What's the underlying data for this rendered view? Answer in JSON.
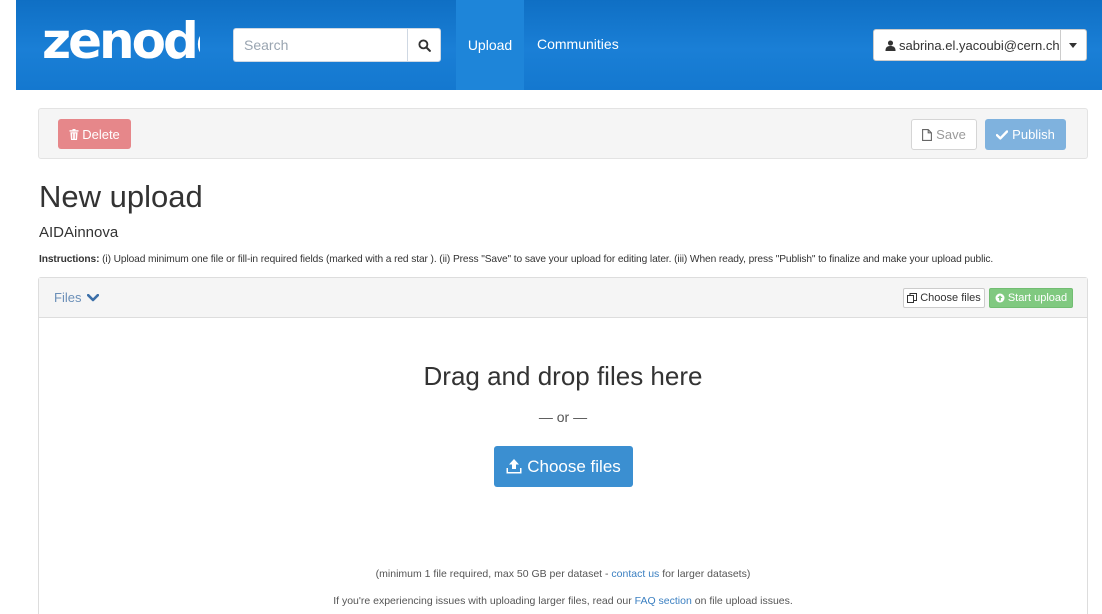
{
  "navbar": {
    "logo_text": "zenodo",
    "search_placeholder": "Search",
    "upload_label": "Upload",
    "communities_label": "Communities",
    "user_email": "sabrina.el.yacoubi@cern.ch"
  },
  "toolbar": {
    "delete_label": "Delete",
    "save_label": "Save",
    "publish_label": "Publish"
  },
  "page": {
    "title": "New upload",
    "community": "AIDAinnova",
    "instructions_label": "Instructions:",
    "instructions_text": " (i) Upload minimum one file or fill-in required fields (marked with a red star ). (ii) Press \"Save\" to save your upload for editing later. (iii) When ready, press \"Publish\" to finalize and make your upload public."
  },
  "files_panel": {
    "heading": "Files",
    "choose_files_small": "Choose files",
    "start_upload": "Start upload",
    "drop_title": "Drag and drop files here",
    "or_text": "— or —",
    "choose_files_large": "Choose files",
    "note1_before": "(minimum 1 file required, max 50 GB per dataset - ",
    "note1_link": "contact us",
    "note1_after": " for larger datasets)",
    "note2_before": "If you're experiencing issues with uploading larger files, read our ",
    "note2_link": "FAQ section",
    "note2_after": " on file upload issues."
  },
  "colors": {
    "navbar": "#1478cf",
    "delete": "#e6878a",
    "publish": "#7fb2de",
    "start_upload": "#80c980",
    "choose_files": "#3b8fd1"
  }
}
